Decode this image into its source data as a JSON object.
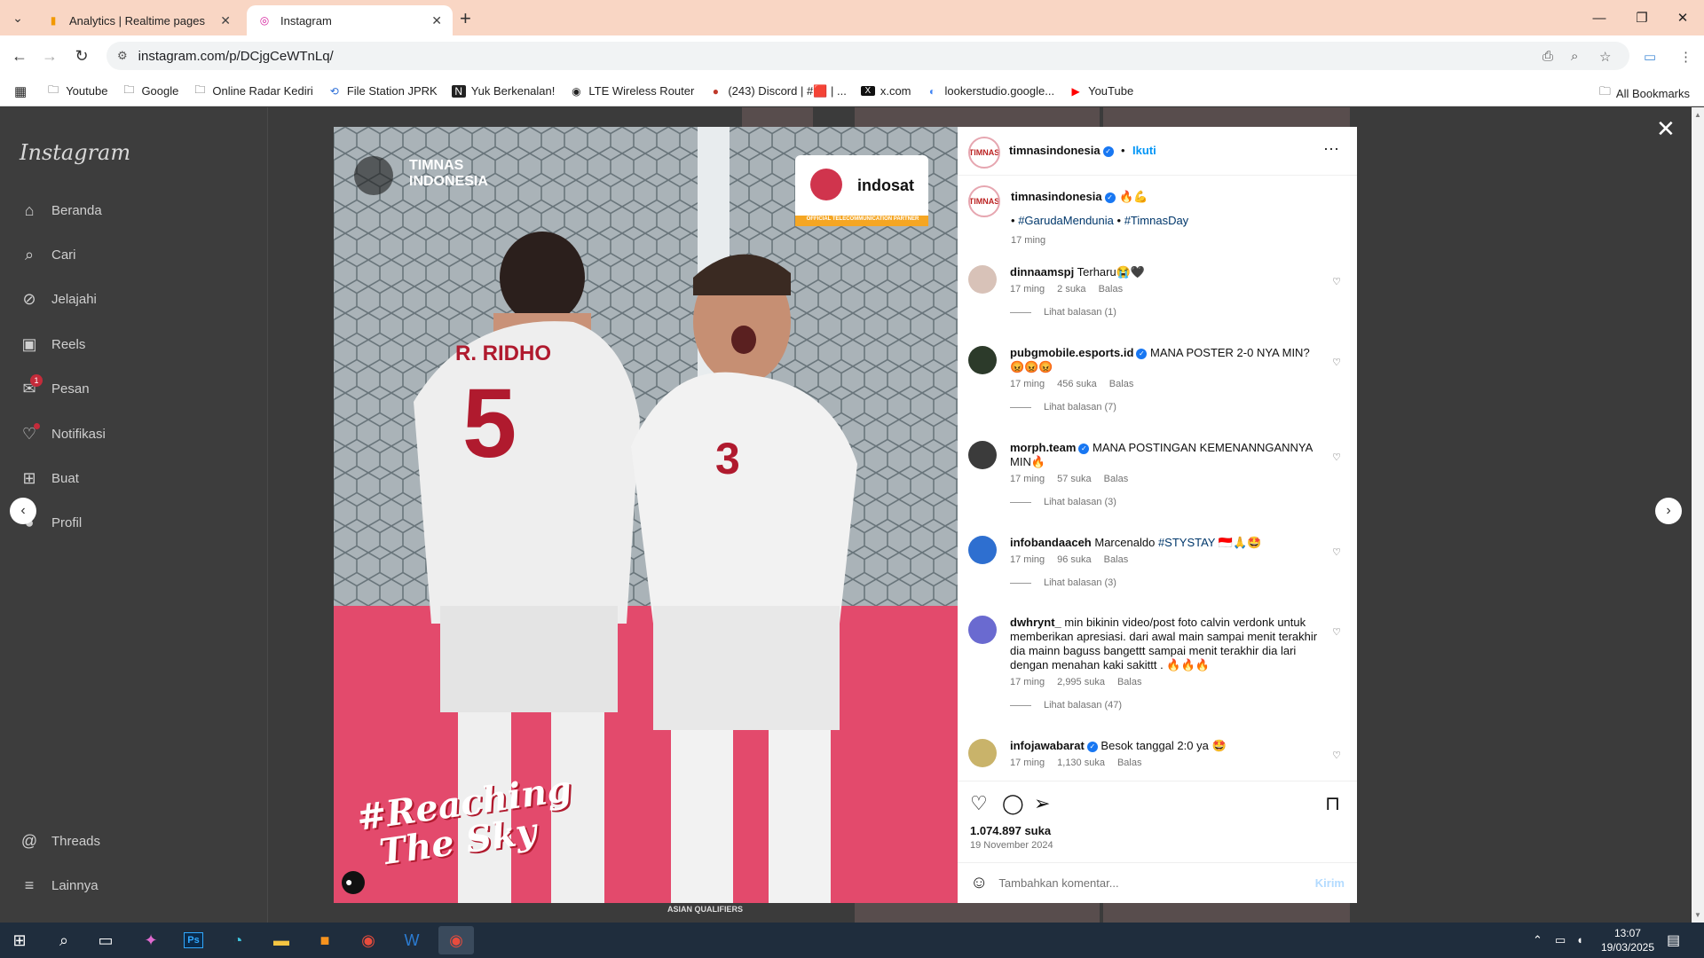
{
  "browser": {
    "tabs": [
      {
        "title": "Analytics | Realtime pages",
        "icon": "analytics-icon",
        "active": false
      },
      {
        "title": "Instagram",
        "icon": "instagram-icon",
        "active": true
      }
    ],
    "url": "instagram.com/p/DCjgCeWTnLq/",
    "bookmarks": [
      {
        "label": "Youtube",
        "icon": "folder-icon"
      },
      {
        "label": "Google",
        "icon": "folder-icon"
      },
      {
        "label": "Online Radar Kediri",
        "icon": "folder-icon"
      },
      {
        "label": "File Station JPRK",
        "icon": "file-station-icon"
      },
      {
        "label": "Yuk Berkenalan!",
        "icon": "notion-icon"
      },
      {
        "label": "LTE Wireless Router",
        "icon": "globe-icon"
      },
      {
        "label": "(243) Discord | #🟥 | ...",
        "icon": "discord-icon"
      },
      {
        "label": "x.com",
        "icon": "x-icon"
      },
      {
        "label": "lookerstudio.google...",
        "icon": "looker-icon"
      },
      {
        "label": "YouTube",
        "icon": "youtube-icon"
      }
    ],
    "all_bookmarks": "All Bookmarks"
  },
  "sidebar": {
    "logo": "Instagram",
    "items": [
      {
        "label": "Beranda",
        "icon": "home-icon"
      },
      {
        "label": "Cari",
        "icon": "search-icon"
      },
      {
        "label": "Jelajahi",
        "icon": "compass-icon"
      },
      {
        "label": "Reels",
        "icon": "reels-icon"
      },
      {
        "label": "Pesan",
        "icon": "messenger-icon",
        "badge": "1"
      },
      {
        "label": "Notifikasi",
        "icon": "heart-icon"
      },
      {
        "label": "Buat",
        "icon": "plus-square-icon"
      },
      {
        "label": "Profil",
        "icon": "profile-icon"
      }
    ],
    "bottom": [
      {
        "label": "Threads",
        "icon": "threads-icon"
      },
      {
        "label": "Lainnya",
        "icon": "menu-icon"
      }
    ]
  },
  "post": {
    "author": "timnasindonesia",
    "follow": "Ikuti",
    "caption_emoji": "🔥💪",
    "hashtag_prefix": "•",
    "hashtags": [
      "#GarudaMendunia",
      "#TimnasDay"
    ],
    "hashtag_sep": "•",
    "caption_time": "17 ming",
    "image": {
      "logo_text": "TIMNAS INDONESIA",
      "sponsor": "indosat",
      "sponsor_tagline": "OFFICIAL TELECOMMUNICATION PARTNER",
      "player1_name": "R. RIDHO",
      "player1_number": "5",
      "player2_number": "3",
      "slogan_line1": "#Reaching",
      "slogan_line2": "The Sky",
      "bottom_strip": "ASIAN QUALIFIERS"
    },
    "likes": "1.074.897 suka",
    "date": "19 November 2024",
    "add_comment_placeholder": "Tambahkan komentar...",
    "post_button": "Kirim"
  },
  "comments": [
    {
      "user": "dinnaamspj",
      "verified": false,
      "text": "Terharu😭🖤",
      "time": "17 ming",
      "likes": "2 suka",
      "reply": "Balas",
      "view_replies": "Lihat balasan (1)"
    },
    {
      "user": "pubgmobile.esports.id",
      "verified": true,
      "text": "MANA POSTER 2-0 NYA MIN?😡😡😡",
      "time": "17 ming",
      "likes": "456 suka",
      "reply": "Balas",
      "view_replies": "Lihat balasan (7)"
    },
    {
      "user": "morph.team",
      "verified": true,
      "text": "MANA POSTINGAN KEMENANNGANNYA MIN🔥",
      "time": "17 ming",
      "likes": "57 suka",
      "reply": "Balas",
      "view_replies": "Lihat balasan (3)"
    },
    {
      "user": "infobandaaceh",
      "verified": false,
      "text": "Marcenaldo",
      "hashtag": "#STYSTAY",
      "text_tail": "🇮🇩🙏🤩",
      "time": "17 ming",
      "likes": "96 suka",
      "reply": "Balas",
      "view_replies": "Lihat balasan (3)"
    },
    {
      "user": "dwhrynt_",
      "verified": false,
      "text": "min bikinin video/post foto calvin verdonk untuk memberikan apresiasi. dari awal main sampai menit terakhir dia mainn baguss bangettt sampai menit terakhir dia lari dengan menahan kaki sakittt . 🔥🔥🔥",
      "time": "17 ming",
      "likes": "2,995 suka",
      "reply": "Balas",
      "view_replies": "Lihat balasan (47)"
    },
    {
      "user": "infojawabarat",
      "verified": true,
      "text": "Besok tanggal 2:0 ya 🤩",
      "time": "17 ming",
      "likes": "1,130 suka",
      "reply": "Balas"
    }
  ],
  "taskbar": {
    "time": "13:07",
    "date": "19/03/2025"
  },
  "colors": {
    "tab_strip": "#f9d6c4",
    "overlay": "#3b3b3b",
    "link": "#00376b",
    "verified": "#1877f2",
    "taskbar": "#1f2d3d"
  }
}
